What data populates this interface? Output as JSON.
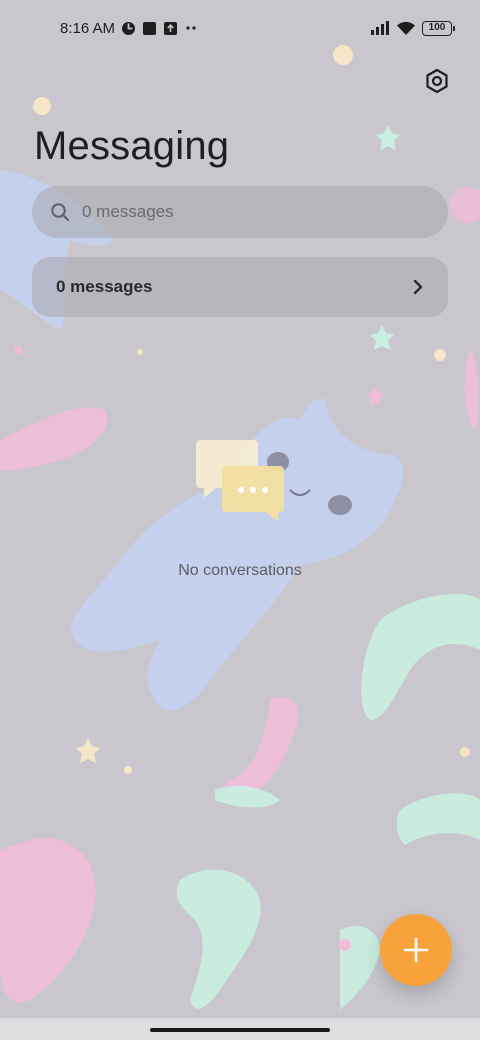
{
  "status_bar": {
    "time": "8:16 AM",
    "battery": "100"
  },
  "header": {
    "title": "Messaging"
  },
  "search": {
    "placeholder": "0 messages"
  },
  "summary": {
    "label": "0 messages"
  },
  "empty_state": {
    "text": "No conversations"
  },
  "colors": {
    "accent": "#f7a23b",
    "background": "#c9c7cd"
  },
  "icons": {
    "settings": "settings-icon",
    "search": "search-icon",
    "chevron": "chevron-right-icon",
    "compose": "plus-icon"
  }
}
